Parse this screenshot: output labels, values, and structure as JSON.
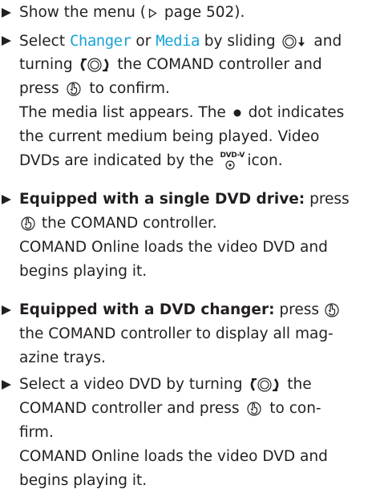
{
  "steps": [
    {
      "lines": [
        [
          "Show the menu (",
          " page 502)."
        ]
      ]
    },
    {
      "lines": [
        [
          "Select ",
          "Changer",
          " or ",
          "Media",
          " by sliding ",
          " and"
        ],
        [
          "turning ",
          " the COMAND controller and"
        ],
        [
          "press ",
          " to confirm."
        ],
        [
          "The media list appears. The ",
          " dot indicates"
        ],
        [
          "the current medium being played. Video"
        ],
        [
          "DVDs are indicated by the ",
          " icon."
        ]
      ],
      "dvd_icon_text": "DVD-V"
    },
    {
      "lines": [
        [
          "Equipped with a single DVD drive:",
          " press"
        ],
        [
          " the COMAND controller."
        ],
        [
          "COMAND Online loads the video DVD and"
        ],
        [
          "begins playing it."
        ]
      ]
    },
    {
      "lines": [
        [
          "Equipped with a DVD changer:",
          " press "
        ],
        [
          "the COMAND controller to display all mag-"
        ],
        [
          "azine trays."
        ]
      ]
    },
    {
      "lines": [
        [
          "Select a video DVD by turning ",
          " the"
        ],
        [
          "COMAND controller and press ",
          " to con-"
        ],
        [
          "firm."
        ],
        [
          "COMAND Online loads the video DVD and"
        ],
        [
          "begins playing it."
        ]
      ]
    }
  ],
  "colors": {
    "text": "#231f20",
    "menu_term": "#1aa3d9"
  },
  "icons": {
    "bullet": "triangle-bullet-icon",
    "page_ref": "page-reference-icon",
    "slide": "slide-down-controller-icon",
    "turn": "turn-controller-icon",
    "press": "press-controller-icon",
    "dot": "current-medium-dot-icon",
    "dvd": "dvd-video-icon"
  }
}
